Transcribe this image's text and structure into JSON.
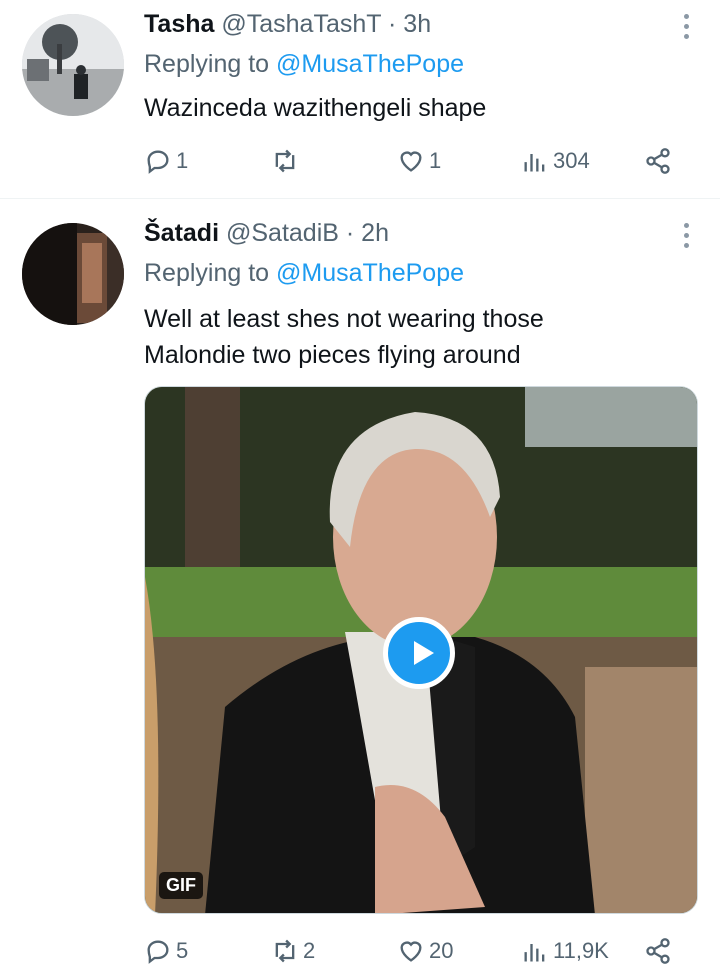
{
  "tweets": [
    {
      "name": "Tasha",
      "handle": "@TashaTashT",
      "time": "· 3h",
      "replying_prefix": "Replying to",
      "replying_to": "@MusaThePope",
      "text_lines": [
        "Wazinceda wazithengeli shape"
      ],
      "stats": {
        "replies": "1",
        "retweets": "",
        "likes": "1",
        "views": "304"
      }
    },
    {
      "name": "Šatadi",
      "handle": "@SatadiB",
      "time": "· 2h",
      "replying_prefix": "Replying to",
      "replying_to": "@MusaThePope",
      "text_lines": [
        "Well at least shes not wearing those",
        "Malondie two pieces flying around"
      ],
      "media": {
        "badge": "GIF"
      },
      "stats": {
        "replies": "5",
        "retweets": "2",
        "likes": "20",
        "views": "11,9K"
      }
    }
  ],
  "icons": [
    "more-icon",
    "reply-icon",
    "retweet-icon",
    "like-icon",
    "views-icon",
    "share-icon",
    "play-icon"
  ],
  "colors": {
    "text": "#0f1419",
    "muted": "#536471",
    "link": "#1d9bf0",
    "divider": "#eff3f4"
  }
}
